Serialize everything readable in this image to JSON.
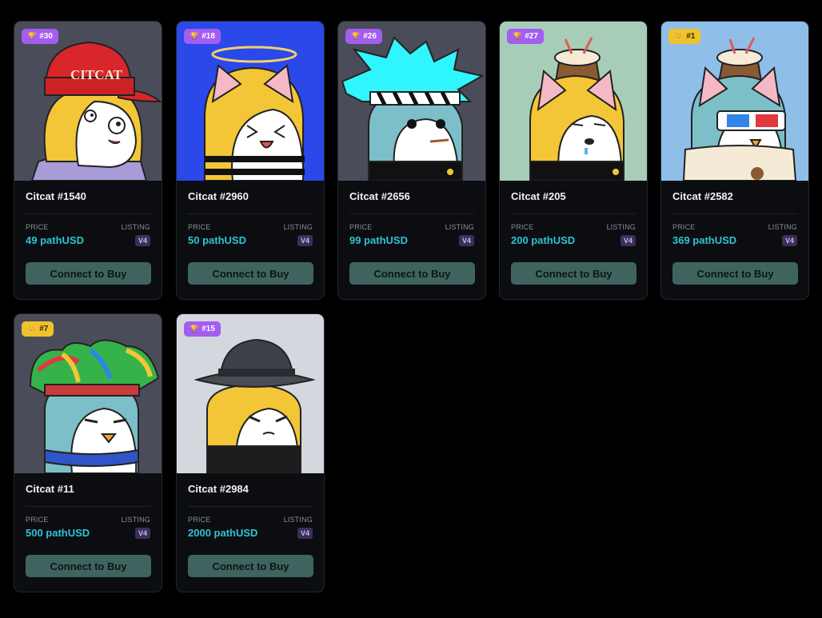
{
  "labels": {
    "price": "PRICE",
    "listing": "LISTING",
    "buy": "Connect to Buy"
  },
  "colors": {
    "page_bg": "#000000",
    "card_bg": "#0c0d11",
    "price": "#2ec3d3",
    "button": "#3f645f",
    "badge_purple": "#a35df0",
    "badge_gold": "#f0c22c"
  },
  "cards": [
    {
      "rank": "#30",
      "badge": "purple",
      "badge_icon": "trophy-icon",
      "title": "Citcat #1540",
      "price": "49 pathUSD",
      "version": "V4",
      "art_bg": "#4a4d59"
    },
    {
      "rank": "#18",
      "badge": "purple",
      "badge_icon": "trophy-icon",
      "title": "Citcat #2960",
      "price": "50 pathUSD",
      "version": "V4",
      "art_bg": "#2b48e8"
    },
    {
      "rank": "#26",
      "badge": "purple",
      "badge_icon": "trophy-icon",
      "title": "Citcat #2656",
      "price": "99 pathUSD",
      "version": "V4",
      "art_bg": "#4a4d59"
    },
    {
      "rank": "#27",
      "badge": "purple",
      "badge_icon": "trophy-icon",
      "title": "Citcat #205",
      "price": "200 pathUSD",
      "version": "V4",
      "art_bg": "#a7cdb8"
    },
    {
      "rank": "#1",
      "badge": "gold",
      "badge_icon": "crown-icon",
      "title": "Citcat #2582",
      "price": "369 pathUSD",
      "version": "V4",
      "art_bg": "#8fbfe9"
    },
    {
      "rank": "#7",
      "badge": "gold",
      "badge_icon": "crown-icon",
      "title": "Citcat #11",
      "price": "500 pathUSD",
      "version": "V4",
      "art_bg": "#4a4d59"
    },
    {
      "rank": "#15",
      "badge": "purple",
      "badge_icon": "trophy-icon",
      "title": "Citcat #2984",
      "price": "2000 pathUSD",
      "version": "V4",
      "art_bg": "#d5d7df"
    }
  ],
  "art_text": {
    "cap_text": "CITCAT"
  }
}
